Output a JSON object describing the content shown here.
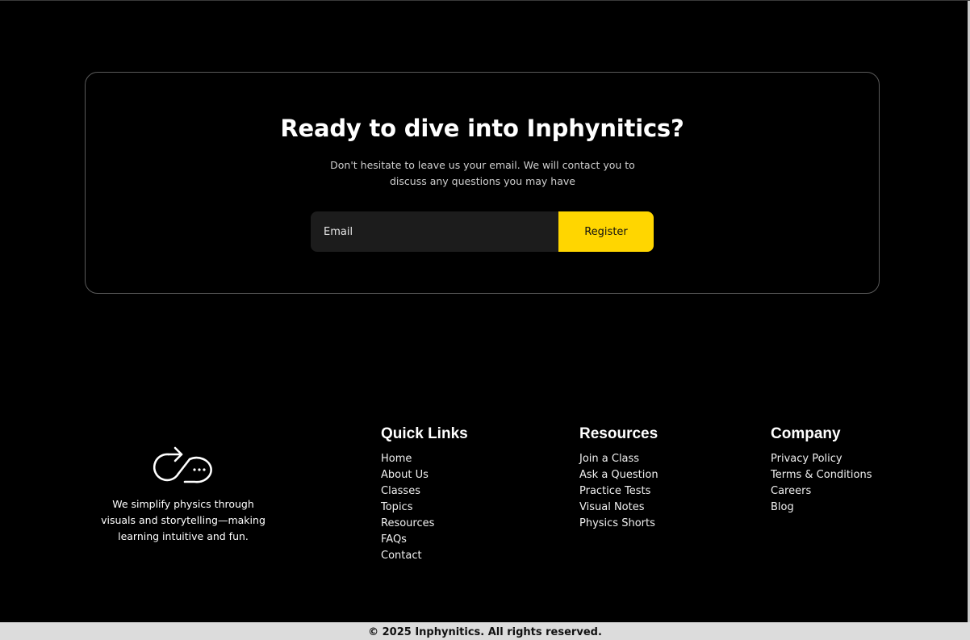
{
  "cta": {
    "title": "Ready to dive into Inphynitics?",
    "subtitle": "Don't hesitate to leave us your email. We will contact you to discuss any questions you may have",
    "email_placeholder": "Email",
    "register_label": "Register",
    "accent_color": "#ffd600"
  },
  "brand": {
    "logo_icon": "infinity-arrow-chat-icon",
    "tagline": "We simplify physics through visuals and storytelling—making learning intuitive and fun."
  },
  "footer": {
    "quick_links": {
      "heading": "Quick Links",
      "items": [
        "Home",
        "About Us",
        "Classes",
        "Topics",
        "Resources",
        "FAQs",
        "Contact"
      ]
    },
    "resources": {
      "heading": "Resources",
      "items": [
        "Join a Class",
        "Ask a Question",
        "Practice Tests",
        "Visual Notes",
        "Physics Shorts"
      ]
    },
    "company": {
      "heading": "Company",
      "items": [
        "Privacy Policy",
        "Terms & Conditions",
        "Careers",
        "Blog"
      ]
    }
  },
  "copyright": "© 2025 Inphynitics. All rights reserved."
}
